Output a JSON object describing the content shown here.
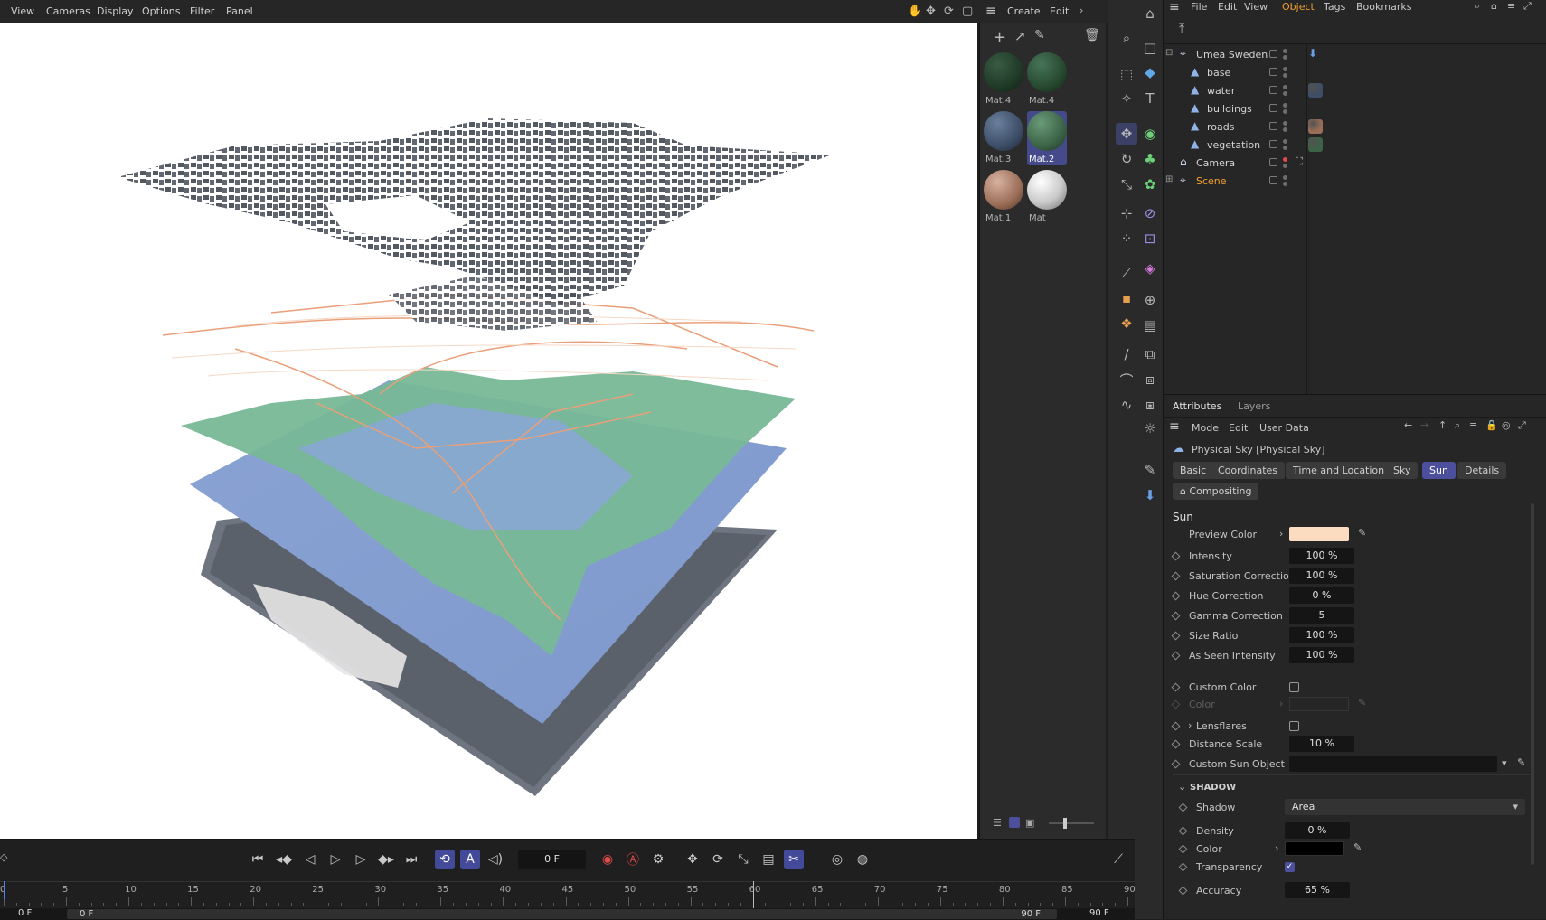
{
  "menubar": {
    "items": [
      "View",
      "Cameras",
      "Display",
      "Options",
      "Filter",
      "Panel"
    ],
    "create": "Create",
    "edit": "Edit"
  },
  "materials": [
    {
      "label": "Mat.4",
      "color": "#1f3a27"
    },
    {
      "label": "Mat.4",
      "color": "#27492f"
    },
    {
      "label": "Mat.3",
      "color": "#3d4e67"
    },
    {
      "label": "Mat.2",
      "color": "#3c6347"
    },
    {
      "label": "Mat.1",
      "color": "#9a6e58"
    },
    {
      "label": "Mat",
      "color": "#c9c9c9"
    }
  ],
  "object_manager": {
    "menu": [
      "File",
      "Edit",
      "View",
      "Object",
      "Tags",
      "Bookmarks"
    ],
    "active_menu": "Object",
    "tree": [
      {
        "name": "Umea Sweden",
        "indent": 0,
        "icon": "null-object-icon",
        "tag": "sky-tag"
      },
      {
        "name": "base",
        "indent": 1,
        "icon": "polygon-icon"
      },
      {
        "name": "water",
        "indent": 1,
        "icon": "polygon-icon",
        "tag": "#3d4e67"
      },
      {
        "name": "buildings",
        "indent": 1,
        "icon": "polygon-icon"
      },
      {
        "name": "roads",
        "indent": 1,
        "icon": "polygon-icon",
        "tag": "#9a6e58"
      },
      {
        "name": "vegetation",
        "indent": 1,
        "icon": "polygon-icon",
        "tag": "#3c6347"
      },
      {
        "name": "Camera",
        "indent": 0,
        "icon": "camera-icon"
      },
      {
        "name": "Scene",
        "indent": 0,
        "icon": "null-object-icon",
        "highlight": true
      }
    ]
  },
  "attributes": {
    "tabs": [
      "Attributes",
      "Layers"
    ],
    "menu": [
      "Mode",
      "Edit",
      "User Data"
    ],
    "object_title": "Physical Sky [Physical Sky]",
    "subtabs": [
      "Basic",
      "Coordinates",
      "Time and Location",
      "Sky",
      "Sun",
      "Details"
    ],
    "active_subtab": "Sun",
    "compositing": "Compositing",
    "section": "Sun",
    "preview_color_label": "Preview Color",
    "preview_color": "#fbdcc1",
    "props": [
      {
        "label": "Intensity",
        "value": "100 %"
      },
      {
        "label": "Saturation Correction",
        "value": "100 %"
      },
      {
        "label": "Hue Correction",
        "value": "0 %"
      },
      {
        "label": "Gamma Correction",
        "value": "5"
      },
      {
        "label": "Size Ratio",
        "value": "100 %"
      },
      {
        "label": "As Seen Intensity",
        "value": "100 %"
      }
    ],
    "custom_color": "Custom Color",
    "color": "Color",
    "lensflares": "Lensflares",
    "distance_scale": {
      "label": "Distance Scale",
      "value": "10 %"
    },
    "custom_sun_object": "Custom Sun Object",
    "shadow_section": "SHADOW",
    "shadow": {
      "label": "Shadow",
      "value": "Area"
    },
    "density": {
      "label": "Density",
      "value": "0 %"
    },
    "shadow_color": {
      "label": "Color",
      "value": "#000000"
    },
    "transparency": {
      "label": "Transparency",
      "checked": true
    },
    "accuracy": {
      "label": "Accuracy",
      "value": "65 %"
    }
  },
  "timeline": {
    "current_frame": "0 F",
    "ruler": [
      "0",
      "5",
      "10",
      "15",
      "20",
      "25",
      "30",
      "35",
      "40",
      "45",
      "50",
      "55",
      "60",
      "65",
      "70",
      "75",
      "80",
      "85",
      "90"
    ],
    "start": "0 F",
    "range_start": "0 F",
    "range_end": "90 F",
    "end": "90 F"
  }
}
